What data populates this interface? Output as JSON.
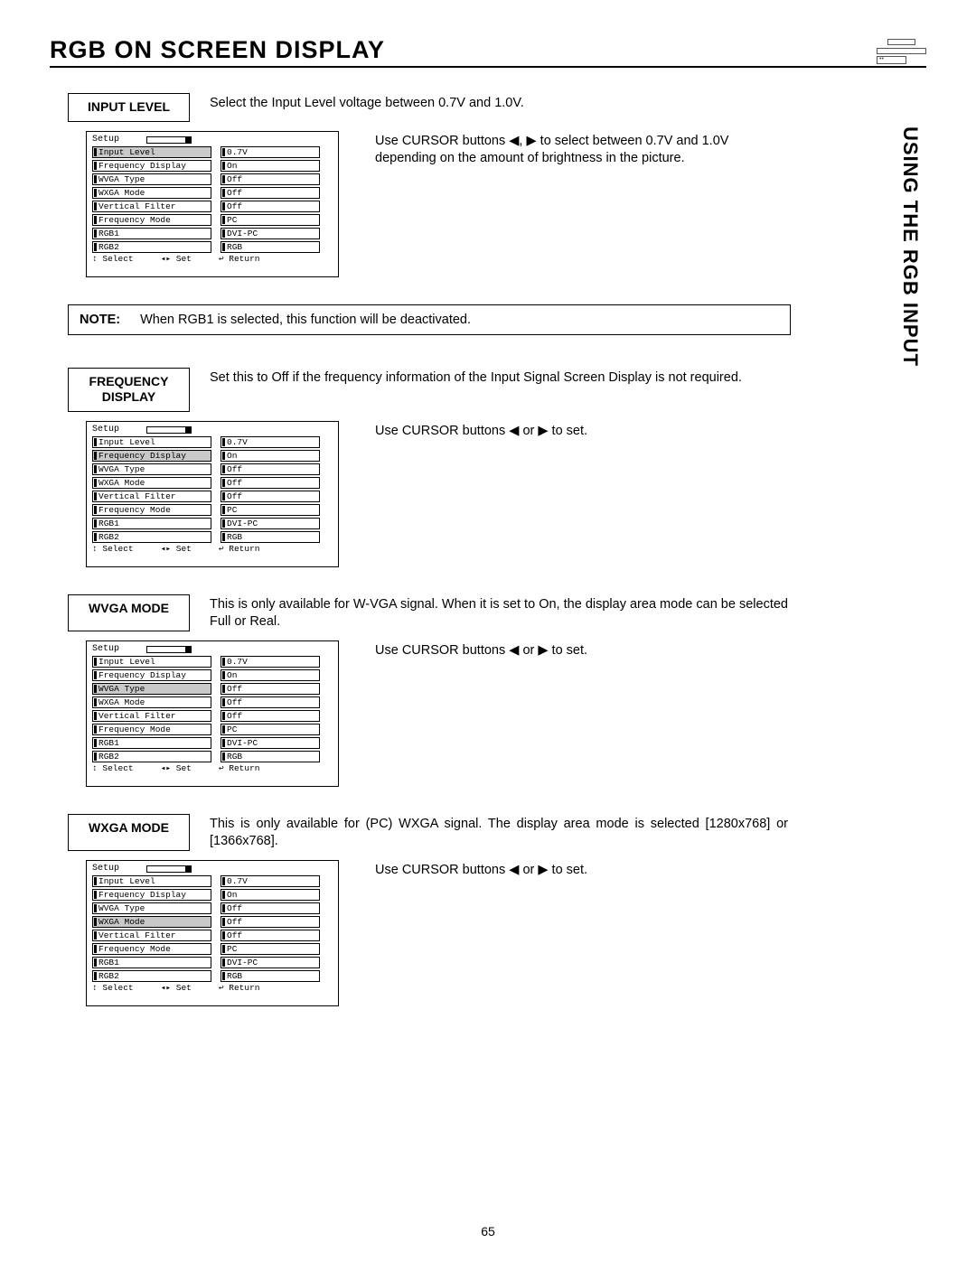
{
  "pageNumber": "65",
  "title": "RGB ON SCREEN DISPLAY",
  "sideTab": "USING THE RGB INPUT",
  "noteLabel": "NOTE:",
  "noteText": "When RGB1 is selected, this function will be deactivated.",
  "setupCommon": {
    "heading": "Setup",
    "footerSelect": "Select",
    "footerSet": "Set",
    "footerReturn": "Return",
    "rows": [
      {
        "label": "Input Level",
        "value": "0.7V"
      },
      {
        "label": "Frequency Display",
        "value": "On"
      },
      {
        "label": "WVGA Type",
        "value": "Off"
      },
      {
        "label": "WXGA Mode",
        "value": "Off"
      },
      {
        "label": "Vertical Filter",
        "value": "Off"
      },
      {
        "label": "Frequency Mode",
        "value": "PC"
      },
      {
        "label": "RGB1",
        "value": "DVI-PC"
      },
      {
        "label": "RGB2",
        "value": "RGB"
      }
    ]
  },
  "sections": [
    {
      "label": "INPUT LEVEL",
      "desc": "Select the Input Level voltage between 0.7V and 1.0V.",
      "side": "Use CURSOR buttons ◀, ▶ to select between 0.7V and 1.0V depending on the amount of brightness in the picture.",
      "highlightIndex": 0,
      "justify": false
    },
    {
      "label": "FREQUENCY DISPLAY",
      "desc": "Set this to Off if the frequency information of the Input Signal Screen Display is not required.",
      "side": "Use CURSOR buttons ◀ or ▶ to set.",
      "highlightIndex": 1,
      "justify": false
    },
    {
      "label": "WVGA MODE",
      "desc": "This is only available for W-VGA signal. When it is set to On, the display area mode can be selected Full or Real.",
      "side": "Use CURSOR buttons ◀ or ▶ to set.",
      "highlightIndex": 2,
      "justify": true
    },
    {
      "label": "WXGA MODE",
      "desc": "This is only available for (PC) WXGA signal. The display area mode is selected [1280x768] or [1366x768].",
      "side": "Use CURSOR buttons ◀ or ▶ to set.",
      "highlightIndex": 3,
      "justify": true
    }
  ]
}
